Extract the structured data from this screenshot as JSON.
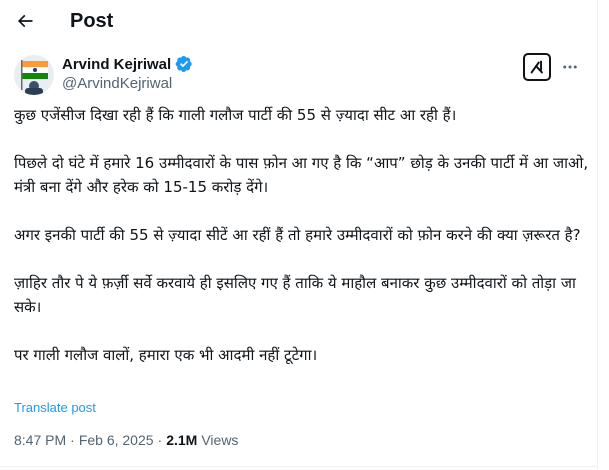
{
  "header": {
    "title": "Post"
  },
  "author": {
    "name": "Arvind Kejriwal",
    "handle": "@ArvindKejriwal"
  },
  "tweet": {
    "paragraphs": [
      "कुछ एजेंसीज दिखा रही हैं कि गाली गलौज पार्टी की 55 से ज़्यादा सीट आ रही हैं।",
      "पिछले दो घंटे में हमारे 16 उम्मीदवारों के पास फ़ोन आ गए है कि “आप” छोड़ के उनकी पार्टी में आ जाओ, मंत्री बना देंगे और हरेक को 15-15 करोड़ देंगे।",
      "अगर इनकी पार्टी की 55 से ज़्यादा सीटें आ रहीं हैं तो हमारे उम्मीदवारों को फ़ोन करने की क्या ज़रूरत है?",
      "ज़ाहिर तौर पे ये फ़र्ज़ी सर्वे करवाये ही इसलिए गए हैं ताकि ये माहौल बनाकर कुछ उम्मीदवारों को तोड़ा जा सके।",
      "पर गाली गलौज वालों, हमारा एक भी आदमी नहीं टूटेगा।"
    ],
    "translate_label": "Translate post",
    "time": "8:47 PM",
    "separator": "·",
    "date": "Feb 6, 2025",
    "views_count": "2.1M",
    "views_label": "Views"
  },
  "colors": {
    "accent": "#1d9bf0",
    "secondary_text": "#536471",
    "text": "#0f1419"
  },
  "icons": {
    "back": "arrow-left-icon",
    "verified": "verified-badge-icon",
    "grok": "grok-icon",
    "more": "more-icon"
  }
}
